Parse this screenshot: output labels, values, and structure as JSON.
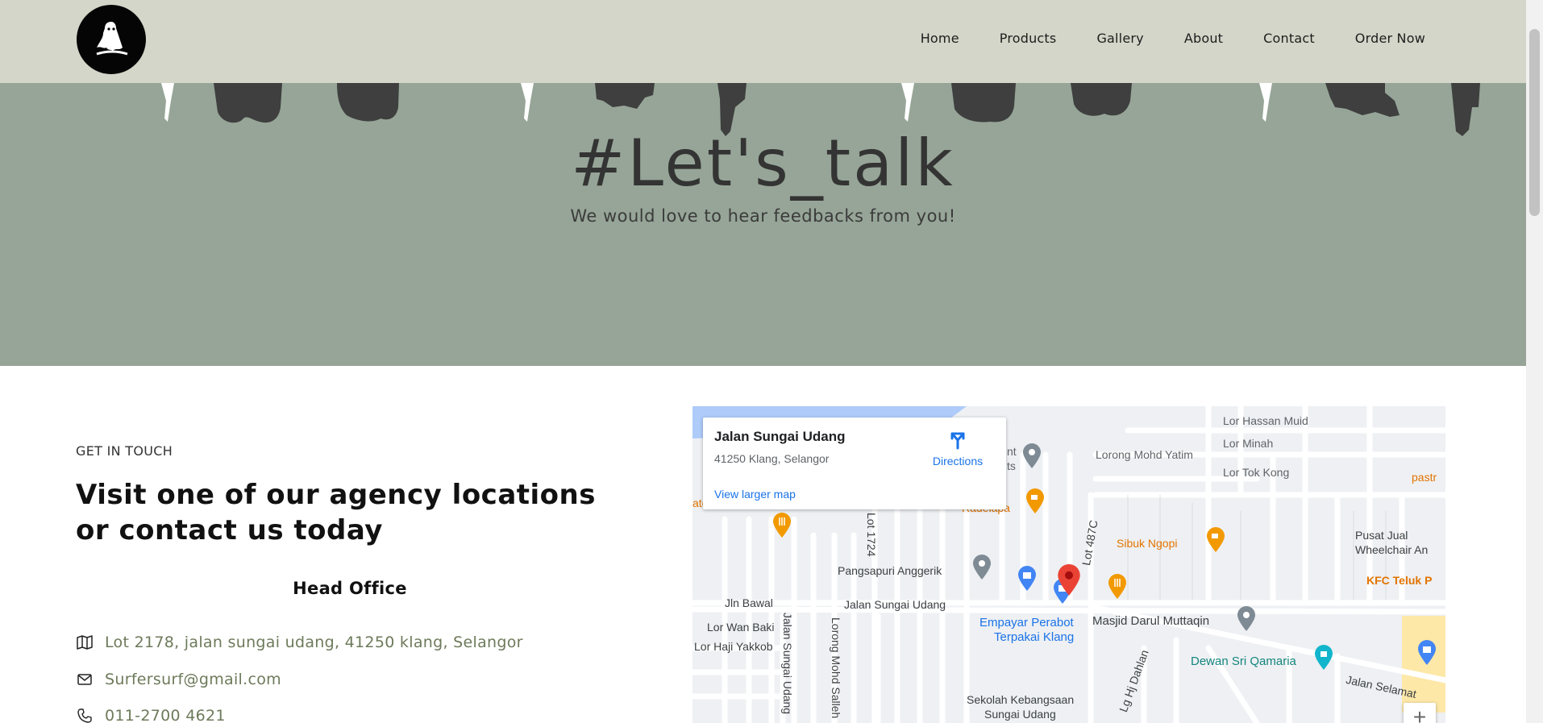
{
  "nav": {
    "logo_icon": "ghost-surfer-logo-icon",
    "items": [
      "Home",
      "Products",
      "Gallery",
      "About",
      "Contact",
      "Order Now"
    ]
  },
  "hero": {
    "title": "#Let's_talk",
    "subtitle": "We would love to hear feedbacks from you!",
    "bg_color": "#96a597"
  },
  "contact": {
    "kicker": "GET IN TOUCH",
    "heading": "Visit one of our agency locations or contact us today",
    "office_title": "Head Office",
    "address": "Lot 2178, jalan sungai udang, 41250 klang, Selangor",
    "email": "Surfersurf@gmail.com",
    "phone": "011-2700 4621",
    "icons": {
      "address": "map-icon",
      "email": "envelope-icon",
      "phone": "phone-icon"
    }
  },
  "map": {
    "card": {
      "title": "Jalan Sungai Udang",
      "address": "41250 Klang, Selangor",
      "link": "View larger map",
      "directions": "Directions"
    },
    "zoom_in": "+",
    "labels": {
      "hassan": "Lor Hassan Muid",
      "minah": "Lor Minah",
      "yatim": "Lorong Mohd Yatim",
      "tokkong": "Lor Tok Kong",
      "pastry": "pastr",
      "pusat1": "Pusat Jual",
      "pusat2": "Wheelchair An",
      "kfc": "KFC Teluk P",
      "nt": "nt",
      "ts": "ts",
      "radelapa": "Radelapa",
      "sibuk": "Sibuk Ngopi",
      "anggerik": "Pangsapuri Anggerik",
      "bawal": "Jln Bawal",
      "sgudang": "Jalan Sungai Udang",
      "wanbaki": "Lor Wan Baki",
      "hajiyakkob": "Lor Haji Yakkob",
      "empayar1": "Empayar Perabot",
      "empayar2": "Terpakai Klang",
      "masjid": "Masjid Darul Muttaqin",
      "dewan": "Dewan Sri Qamaria",
      "selamat": "Jalan Selamat",
      "sekolah1": "Sekolah Kebangsaan",
      "sekolah2": "Sungai Udang",
      "lot1724": "Lot 1724",
      "lot487c": "Lot 487C",
      "jsu_vert": "Jalan Sungai Udang",
      "lms_vert": "Lorong Mohd Salleh",
      "dahlan": "Lg Hj Dahlan",
      "ate": "ate"
    }
  }
}
